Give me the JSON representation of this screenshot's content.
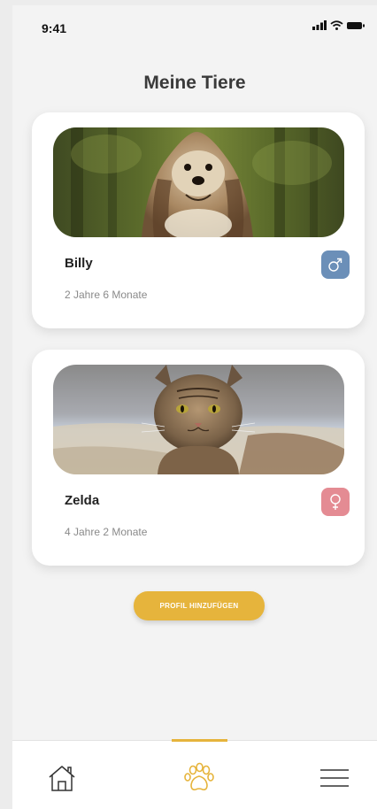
{
  "status_bar": {
    "time": "9:41",
    "icons": [
      "signal-icon",
      "wifi-icon",
      "battery-icon"
    ]
  },
  "header": {
    "title": "Meine Tiere"
  },
  "pets": [
    {
      "name": "Billy",
      "age": "2 Jahre 6 Monate",
      "gender_icon": "male-icon",
      "image": "dog-photo"
    },
    {
      "name": "Zelda",
      "age": "4 Jahre 2 Monate",
      "gender_icon": "female-icon",
      "image": "cat-photo"
    }
  ],
  "add_button": {
    "label": "PROFIL HINZUFÜGEN"
  },
  "tab_bar": {
    "items": [
      "home-icon",
      "paw-icon",
      "menu-icon"
    ],
    "active": "paw-icon"
  },
  "colors": {
    "accent": "#e6b43c",
    "male": "#6b8fb8",
    "female": "#e48b93",
    "background": "#f3f3f3",
    "title": "#3a3a3a"
  }
}
